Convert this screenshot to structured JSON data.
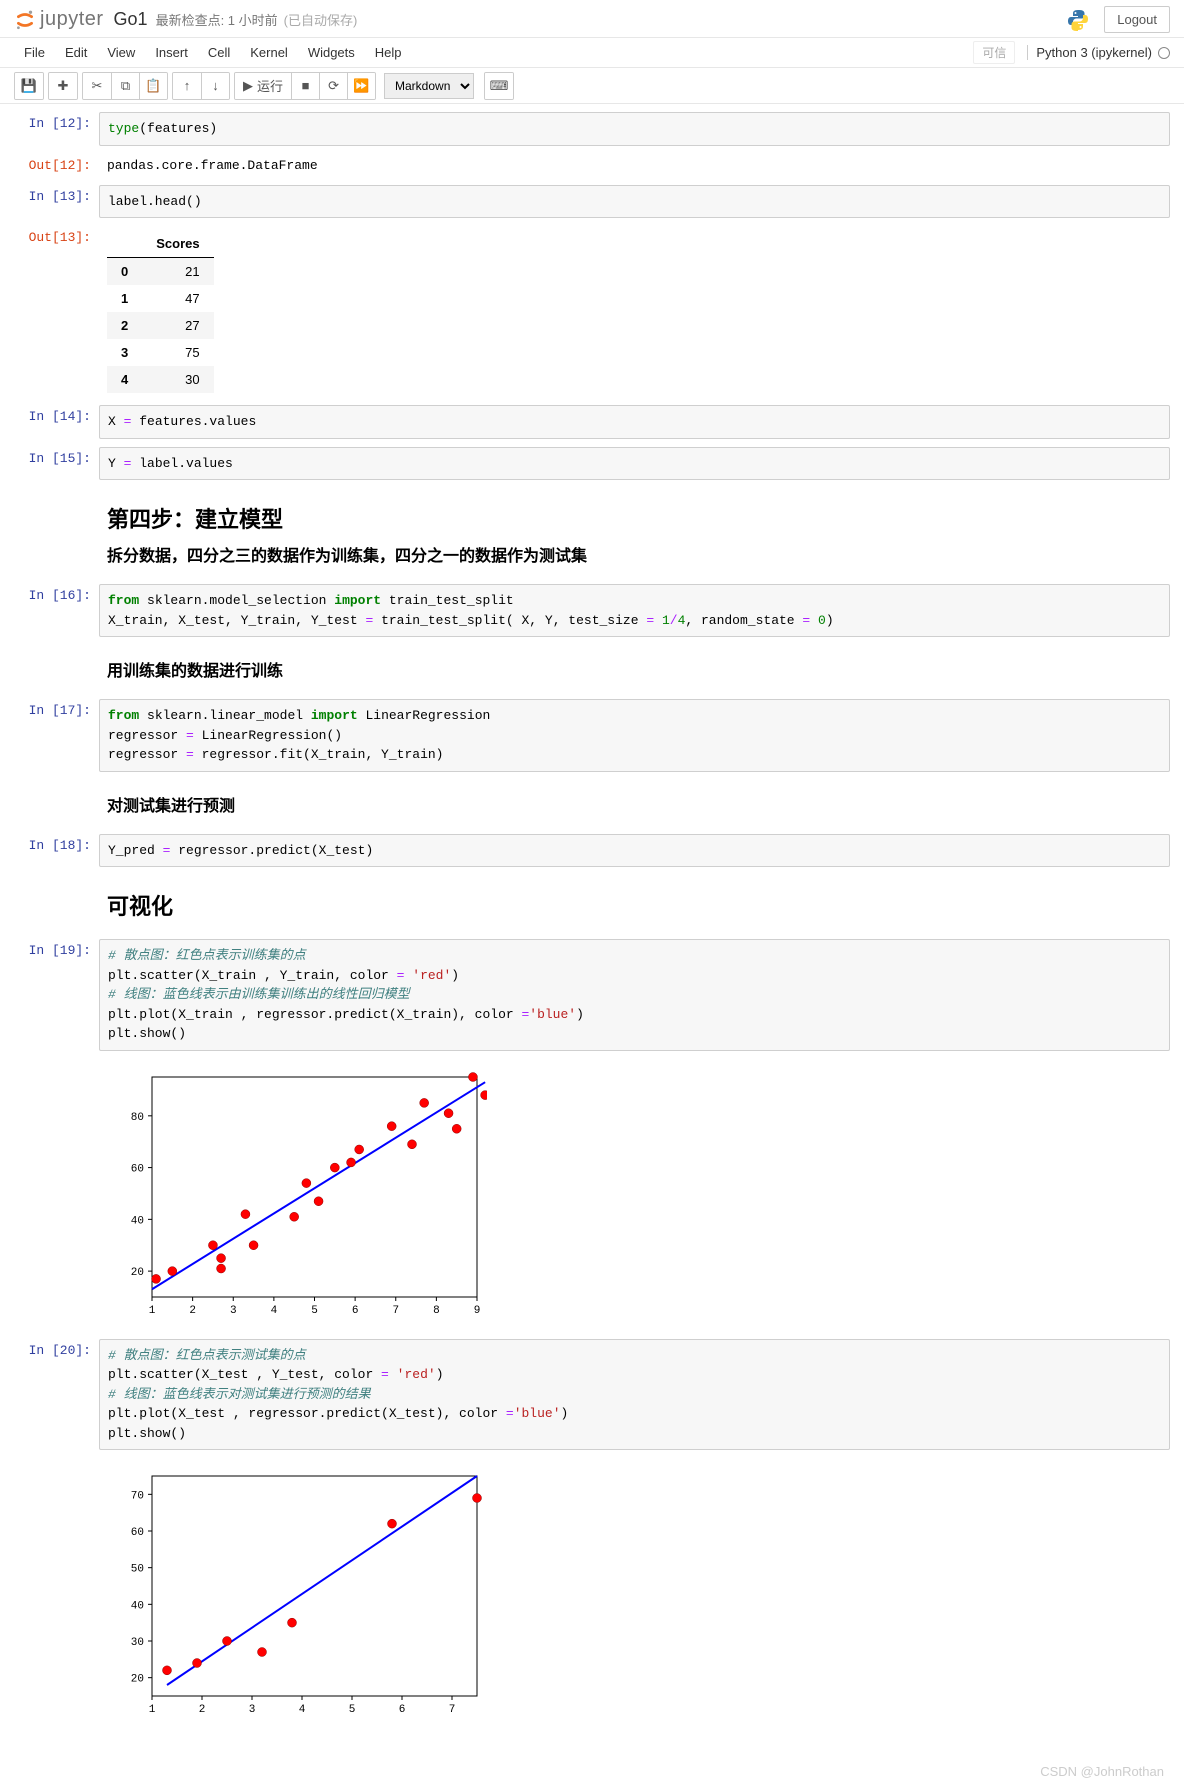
{
  "header": {
    "logo_text": "jupyter",
    "title": "Go1",
    "checkpoint": "最新检查点: 1 小时前",
    "autosave": "(已自动保存)",
    "logout": "Logout"
  },
  "menubar": {
    "items": [
      "File",
      "Edit",
      "View",
      "Insert",
      "Cell",
      "Kernel",
      "Widgets",
      "Help"
    ],
    "trusted": "可信",
    "kernel": "Python 3 (ipykernel)"
  },
  "toolbar": {
    "run_label": "运行",
    "celltype_selected": "Markdown"
  },
  "cells": {
    "c12": {
      "in_prompt": "In  [12]:",
      "out_prompt": "Out[12]:",
      "output_text": "pandas.core.frame.DataFrame"
    },
    "c13": {
      "in_prompt": "In  [13]:",
      "out_prompt": "Out[13]:",
      "table_header": "Scores",
      "rows": [
        {
          "idx": "0",
          "val": "21"
        },
        {
          "idx": "1",
          "val": "47"
        },
        {
          "idx": "2",
          "val": "27"
        },
        {
          "idx": "3",
          "val": "75"
        },
        {
          "idx": "4",
          "val": "30"
        }
      ]
    },
    "c14": {
      "in_prompt": "In  [14]:"
    },
    "c15": {
      "in_prompt": "In  [15]:"
    },
    "md_step4": {
      "h2": "第四步：建立模型",
      "h3": "拆分数据，四分之三的数据作为训练集，四分之一的数据作为测试集"
    },
    "c16": {
      "in_prompt": "In  [16]:"
    },
    "md_train": {
      "h3": "用训练集的数据进行训练"
    },
    "c17": {
      "in_prompt": "In  [17]:"
    },
    "md_pred": {
      "h3": "对测试集进行预测"
    },
    "c18": {
      "in_prompt": "In  [18]:"
    },
    "md_vis": {
      "h2": "可视化"
    },
    "c19": {
      "in_prompt": "In  [19]:"
    },
    "c20": {
      "in_prompt": "In  [20]:"
    }
  },
  "chart_data": [
    {
      "type": "scatter+line",
      "title": "",
      "xlabel": "",
      "ylabel": "",
      "xlim": [
        1,
        9
      ],
      "ylim": [
        10,
        95
      ],
      "xticks": [
        1,
        2,
        3,
        4,
        5,
        6,
        7,
        8,
        9
      ],
      "yticks": [
        20,
        40,
        60,
        80
      ],
      "scatter_color": "red",
      "line_color": "blue",
      "scatter": [
        {
          "x": 1.1,
          "y": 17
        },
        {
          "x": 1.5,
          "y": 20
        },
        {
          "x": 2.5,
          "y": 30
        },
        {
          "x": 2.7,
          "y": 25
        },
        {
          "x": 2.7,
          "y": 21
        },
        {
          "x": 3.3,
          "y": 42
        },
        {
          "x": 3.5,
          "y": 30
        },
        {
          "x": 4.5,
          "y": 41
        },
        {
          "x": 4.8,
          "y": 54
        },
        {
          "x": 5.1,
          "y": 47
        },
        {
          "x": 5.5,
          "y": 60
        },
        {
          "x": 5.9,
          "y": 62
        },
        {
          "x": 6.1,
          "y": 67
        },
        {
          "x": 6.9,
          "y": 76
        },
        {
          "x": 7.4,
          "y": 69
        },
        {
          "x": 7.7,
          "y": 85
        },
        {
          "x": 8.3,
          "y": 81
        },
        {
          "x": 8.5,
          "y": 75
        },
        {
          "x": 8.9,
          "y": 95
        },
        {
          "x": 9.2,
          "y": 88
        }
      ],
      "line": [
        {
          "x": 1.0,
          "y": 13
        },
        {
          "x": 9.2,
          "y": 93
        }
      ]
    },
    {
      "type": "scatter+line",
      "title": "",
      "xlabel": "",
      "ylabel": "",
      "xlim": [
        1,
        7.5
      ],
      "ylim": [
        15,
        75
      ],
      "xticks": [
        1,
        2,
        3,
        4,
        5,
        6,
        7
      ],
      "yticks": [
        20,
        30,
        40,
        50,
        60,
        70
      ],
      "scatter_color": "red",
      "line_color": "blue",
      "scatter": [
        {
          "x": 1.3,
          "y": 22
        },
        {
          "x": 1.9,
          "y": 24
        },
        {
          "x": 2.5,
          "y": 30
        },
        {
          "x": 3.2,
          "y": 27
        },
        {
          "x": 3.8,
          "y": 35
        },
        {
          "x": 5.8,
          "y": 62
        },
        {
          "x": 7.5,
          "y": 69
        }
      ],
      "line": [
        {
          "x": 1.3,
          "y": 18
        },
        {
          "x": 7.5,
          "y": 75
        }
      ]
    }
  ],
  "watermark": "CSDN @JohnRothan"
}
